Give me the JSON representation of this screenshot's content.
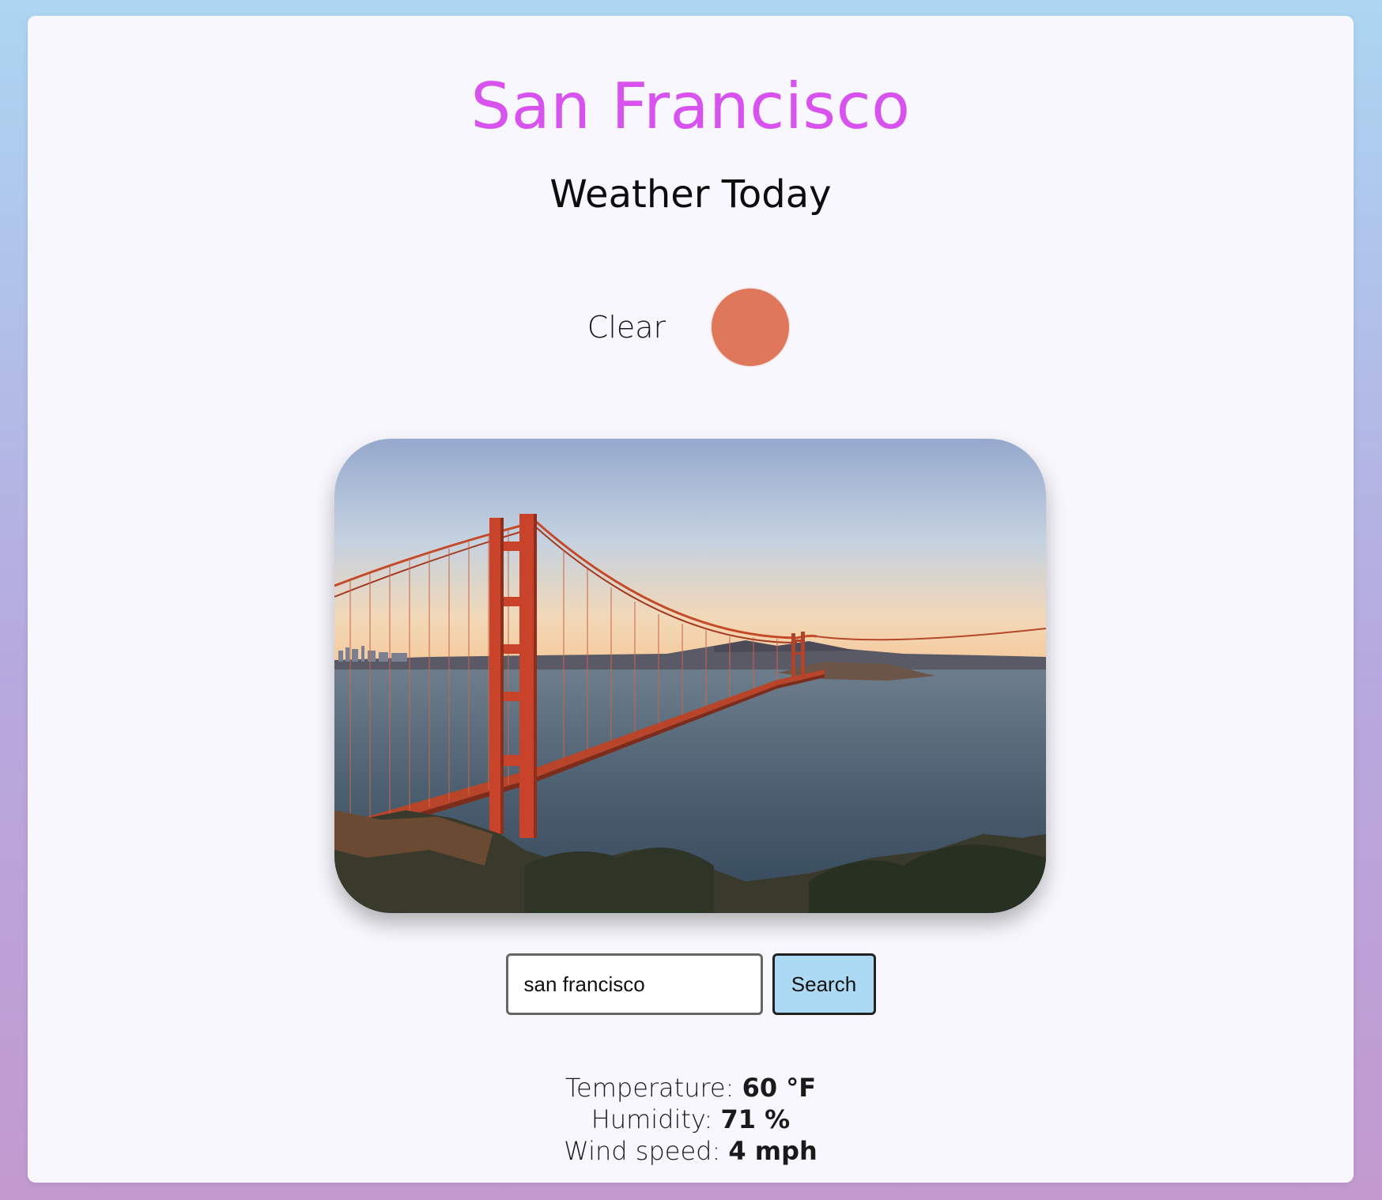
{
  "header": {
    "city": "San Francisco",
    "subtitle": "Weather Today"
  },
  "condition": {
    "label": "Clear",
    "icon": "sun-icon",
    "icon_color": "#df775a"
  },
  "image": {
    "icon": "golden-gate-bridge-photo"
  },
  "search": {
    "value": "san francisco",
    "button_label": "Search"
  },
  "stats": {
    "temperature_label": "Temperature:",
    "temperature_value": "60 °F",
    "humidity_label": "Humidity:",
    "humidity_value": "71 %",
    "wind_label": "Wind speed:",
    "wind_value": "4 mph"
  },
  "colors": {
    "accent": "#d852ef",
    "button": "#acd9f3"
  }
}
